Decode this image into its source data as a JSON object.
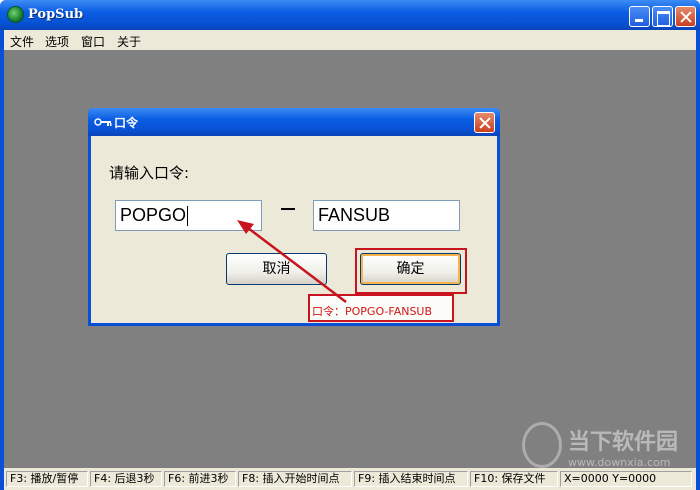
{
  "window": {
    "title": "PopSub"
  },
  "menu": [
    "文件",
    "选项",
    "窗口",
    "关于"
  ],
  "dialog": {
    "title": "口令",
    "prompt": "请输入口令:",
    "field1": "POPGO",
    "field2": "FANSUB",
    "cancel_label": "取消",
    "ok_label": "确定"
  },
  "annotation": {
    "note": "口令：POPGO-FANSUB",
    "color": "#c8141e"
  },
  "statusbar": [
    "F3: 播放/暂停",
    "F4: 后退3秒",
    "F6: 前进3秒",
    "F8: 插入开始时间点",
    "F9: 插入结束时间点",
    "F10: 保存文件",
    "X=0000  Y=0000"
  ],
  "watermark": {
    "text": "当下软件园",
    "url": "www.downxia.com"
  }
}
